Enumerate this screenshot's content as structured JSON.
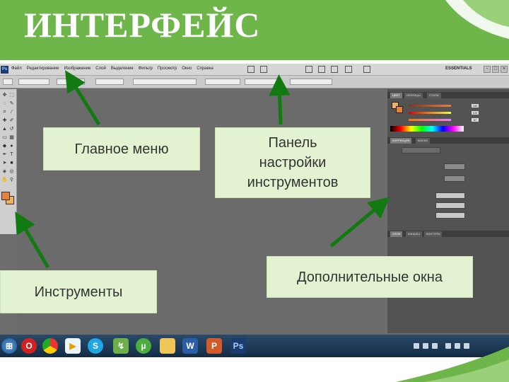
{
  "slide": {
    "title": "ИНТЕРФЕЙС",
    "header_color": "#6fb64a",
    "label_bg_color": "#e3f3d2",
    "arrow_color": "#117a11"
  },
  "annotations": {
    "main_menu": "Главное меню",
    "options_panel": [
      "Панель",
      "настройки",
      "инструментов"
    ],
    "tools": "Инструменты",
    "extra_windows": "Дополнительные окна"
  },
  "photoshop": {
    "logo": "Ps",
    "menu": [
      "Файл",
      "Редактирование",
      "Изображение",
      "Слой",
      "Выделение",
      "Фильтр",
      "Просмотр",
      "Окно",
      "Справка"
    ],
    "workspace": "ESSENTIALS",
    "window_buttons": [
      "-",
      "□",
      "×"
    ],
    "panels": {
      "color_tabs": [
        "ЦВЕТ",
        "ОБРАЗЦЫ",
        "СТИЛИ"
      ],
      "adjust_tabs": [
        "КОРРЕКЦИЯ",
        "МАСКИ"
      ],
      "bottom_tabs": [
        "СЛОИ",
        "КАНАЛЫ",
        "КОНТУРЫ"
      ],
      "r_value": "240",
      "g_value": "122",
      "b_value": "67",
      "fg_color": "#e8823a",
      "bg_color": "#f1b15f"
    },
    "taskbar_icons": [
      "windows-start-icon",
      "opera-icon",
      "chrome-icon",
      "media-player-icon",
      "skype-icon",
      "network-icon",
      "utorrent-icon",
      "folder-icon",
      "word-icon",
      "powerpoint-icon",
      "photoshop-icon"
    ]
  }
}
